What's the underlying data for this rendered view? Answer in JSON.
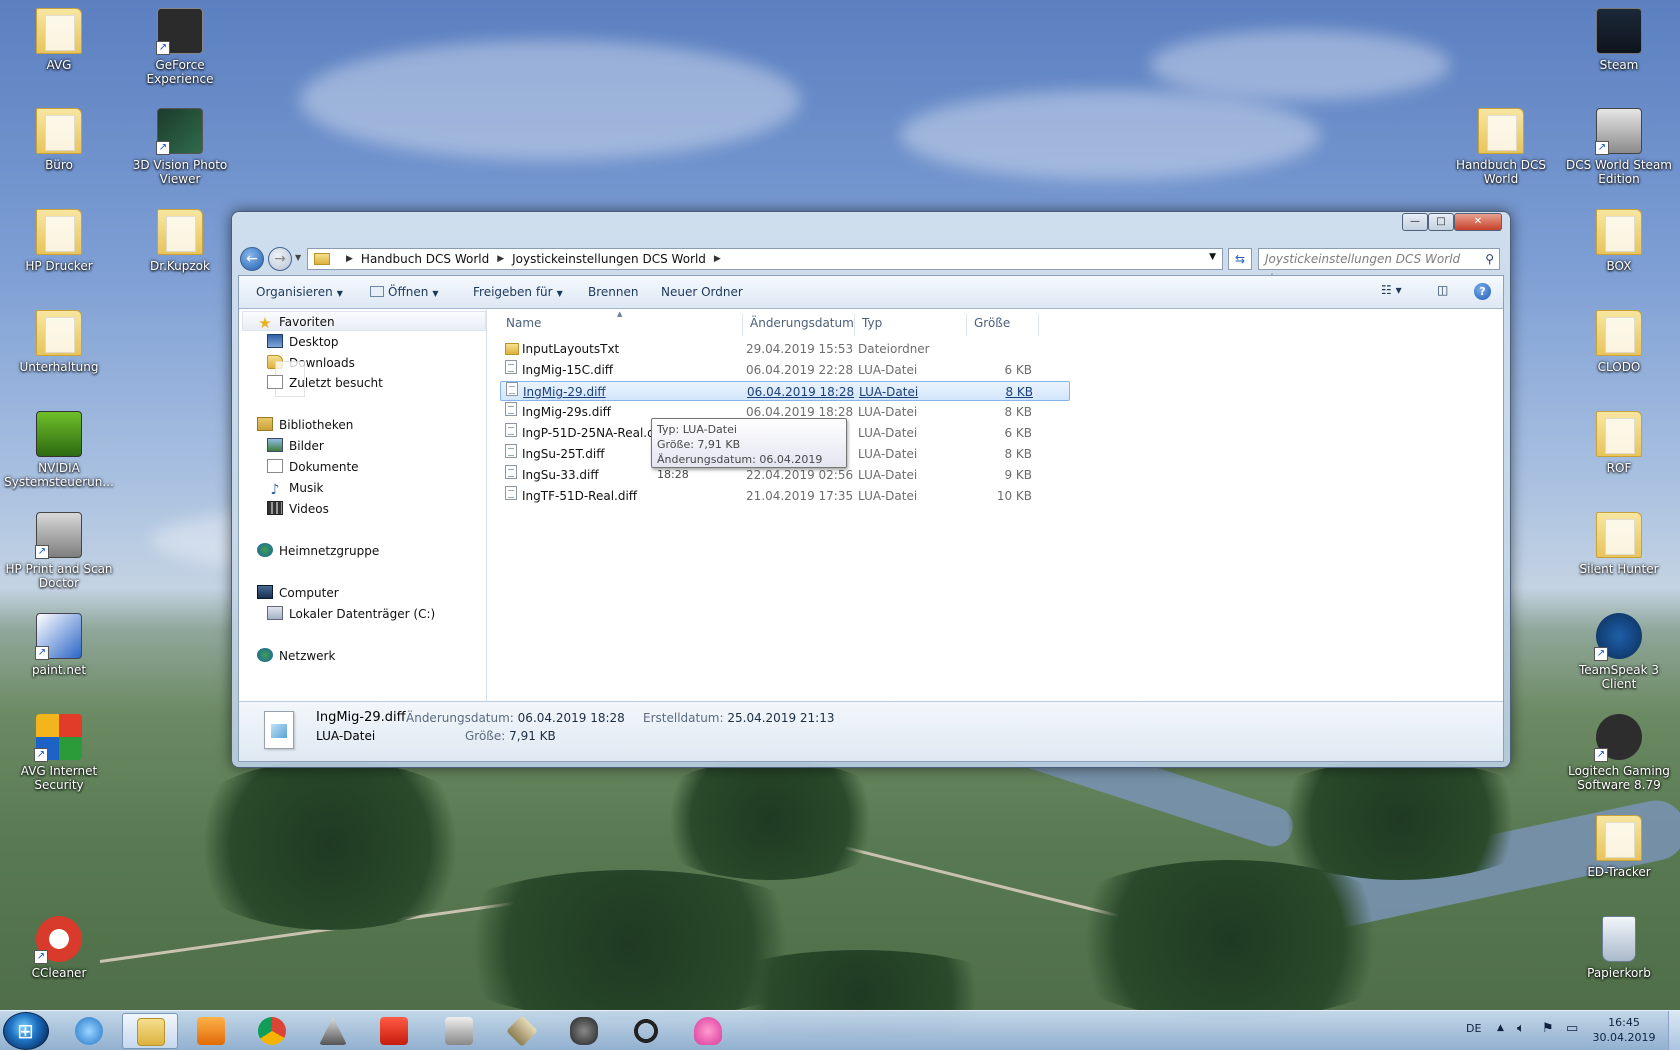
{
  "desktop_icons_left": [
    {
      "label": "AVG",
      "kind": "folder"
    },
    {
      "label": "GeForce Experience",
      "kind": "app"
    },
    {
      "label": "Büro",
      "kind": "folder"
    },
    {
      "label": "3D Vision Photo Viewer",
      "kind": "app"
    },
    {
      "label": "HP Drucker",
      "kind": "folder"
    },
    {
      "label": "Dr.Kupzok",
      "kind": "folder"
    },
    {
      "label": "Unterhaltung",
      "kind": "folder"
    },
    {
      "label": "NVIDIA Systemsteuerun...",
      "kind": "app"
    },
    {
      "label": "HP Print and Scan Doctor",
      "kind": "app"
    },
    {
      "label": "paint.net",
      "kind": "app"
    },
    {
      "label": "AVG Internet Security",
      "kind": "app"
    },
    {
      "label": "CCleaner",
      "kind": "app"
    }
  ],
  "desktop_icons_right": [
    {
      "label": "Steam",
      "kind": "app"
    },
    {
      "label": "Handbuch DCS World",
      "kind": "folder"
    },
    {
      "label": "DCS World Steam Edition",
      "kind": "app"
    },
    {
      "label": "BOX",
      "kind": "folder"
    },
    {
      "label": "CLODO",
      "kind": "folder"
    },
    {
      "label": "ROF",
      "kind": "folder"
    },
    {
      "label": "Silent Hunter",
      "kind": "folder"
    },
    {
      "label": "TeamSpeak 3 Client",
      "kind": "app"
    },
    {
      "label": "Logitech Gaming Software 8.79",
      "kind": "app"
    },
    {
      "label": "ED-Tracker",
      "kind": "folder"
    },
    {
      "label": "Papierkorb",
      "kind": "app"
    }
  ],
  "window": {
    "min_glyph": "—",
    "max_glyph": "□",
    "close_glyph": "✕",
    "breadcrumb": [
      "Handbuch DCS World",
      "Joystickeinstellungen DCS World"
    ],
    "search_placeholder": "Joystickeinstellungen DCS World durc..."
  },
  "toolbar": {
    "organize": "Organisieren",
    "open": "Öffnen",
    "share": "Freigeben für",
    "burn": "Brennen",
    "new_folder": "Neuer Ordner",
    "help": "?"
  },
  "nav": {
    "favorites": "Favoriten",
    "desktop": "Desktop",
    "downloads": "Downloads",
    "recent": "Zuletzt besucht",
    "libraries": "Bibliotheken",
    "pictures": "Bilder",
    "documents": "Dokumente",
    "music": "Musik",
    "videos": "Videos",
    "homegroup": "Heimnetzgruppe",
    "computer": "Computer",
    "local_disk": "Lokaler Datenträger (C:)",
    "network": "Netzwerk"
  },
  "columns": {
    "name": "Name",
    "date": "Änderungsdatum",
    "type": "Typ",
    "size": "Größe"
  },
  "files": [
    {
      "name": "InputLayoutsTxt",
      "date": "29.04.2019 15:53",
      "type": "Dateiordner",
      "size": "",
      "icon": "folder",
      "selected": false
    },
    {
      "name": "IngMig-15C.diff",
      "date": "06.04.2019 22:28",
      "type": "LUA-Datei",
      "size": "6 KB",
      "icon": "lua",
      "selected": false
    },
    {
      "name": "IngMig-29.diff",
      "date": "06.04.2019 18:28",
      "type": "LUA-Datei",
      "size": "8 KB",
      "icon": "lua",
      "selected": true
    },
    {
      "name": "IngMig-29s.diff",
      "date": "06.04.2019 18:28",
      "type": "LUA-Datei",
      "size": "8 KB",
      "icon": "lua",
      "selected": false
    },
    {
      "name": "IngP-51D-25NA-Real.diff",
      "date": "",
      "type": "LUA-Datei",
      "size": "6 KB",
      "icon": "lua",
      "selected": false
    },
    {
      "name": "IngSu-25T.diff",
      "date": "",
      "type": "LUA-Datei",
      "size": "8 KB",
      "icon": "lua",
      "selected": false
    },
    {
      "name": "IngSu-33.diff",
      "date": "22.04.2019 02:56",
      "type": "LUA-Datei",
      "size": "9 KB",
      "icon": "lua",
      "selected": false
    },
    {
      "name": "IngTF-51D-Real.diff",
      "date": "21.04.2019 17:35",
      "type": "LUA-Datei",
      "size": "10 KB",
      "icon": "lua",
      "selected": false
    }
  ],
  "tooltip": {
    "line1": "Typ: LUA-Datei",
    "line2": "Größe: 7,91 KB",
    "line3": "Änderungsdatum: 06.04.2019 18:28"
  },
  "details": {
    "filename": "IngMig-29.diff",
    "filetype": "LUA-Datei",
    "modified_label": "Änderungsdatum:",
    "modified_value": "06.04.2019 18:28",
    "size_label": "Größe:",
    "size_value": "7,91 KB",
    "created_label": "Erstelldatum:",
    "created_value": "25.04.2019 21:13"
  },
  "taskbar": {
    "apps": [
      "start",
      "internet-explorer",
      "windows-explorer",
      "media-player",
      "chrome",
      "dcs",
      "avg",
      "pwcg",
      "rof",
      "alien",
      "logitech",
      "octopus"
    ],
    "language": "DE",
    "time": "16:45",
    "date": "30.04.2019"
  }
}
